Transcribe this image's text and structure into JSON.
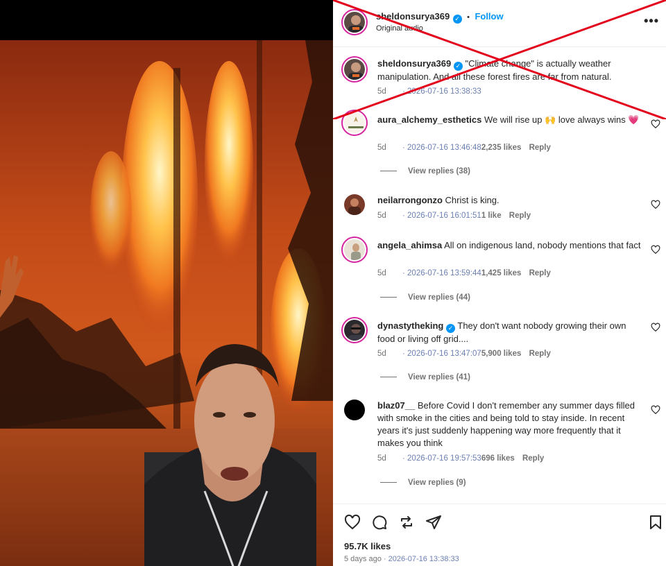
{
  "post": {
    "username": "sheldonsurya369",
    "follow_label": "Follow",
    "audio": "Original audio",
    "more_label": "•••",
    "caption": "\"Climate change\" is actually weather manipulation. And all these forest fires are far from natural.",
    "caption_age": "5d",
    "caption_timestamp": "· 2026-07-16 13:38:33"
  },
  "comments": [
    {
      "username": "aura_alchemy_esthetics",
      "text": "We will rise up 🙌 love always wins 💗",
      "age": "5d",
      "timestamp": "· 2026-07-16 13:46:48",
      "likes": "2,235 likes",
      "reply": "Reply",
      "view_replies": "View replies (38)"
    },
    {
      "username": "neilarrongonzo",
      "text": "Christ is king.",
      "age": "5d",
      "timestamp": "· 2026-07-16 16:01:51",
      "likes": "1 like",
      "reply": "Reply"
    },
    {
      "username": "angela_ahimsa",
      "text": "All on indigenous land, nobody mentions that fact",
      "age": "5d",
      "timestamp": "· 2026-07-16 13:59:44",
      "likes": "1,425 likes",
      "reply": "Reply",
      "view_replies": "View replies (44)"
    },
    {
      "username": "dynastytheking",
      "text": "They don't want nobody growing their own food or living off grid....",
      "age": "5d",
      "timestamp": "· 2026-07-16 13:47:07",
      "likes": "5,900 likes",
      "reply": "Reply",
      "view_replies": "View replies (41)"
    },
    {
      "username": "blaz07__",
      "text": "Before Covid I don't remember any summer days filled with smoke in the cities and being told to stay inside. In recent years it's just suddenly happening way more frequently that it makes you think",
      "age": "5d",
      "timestamp": "· 2026-07-16 19:57:53",
      "likes": "696 likes",
      "reply": "Reply",
      "view_replies": "View replies (9)"
    }
  ],
  "footer": {
    "likes": "95.7K likes",
    "age": "5 days ago",
    "timestamp": "· 2026-07-16 13:38:33"
  },
  "icons": {
    "like": "heart-icon",
    "comment": "comment-icon",
    "share": "repost-icon",
    "send": "send-icon",
    "save": "bookmark-icon"
  },
  "colors": {
    "accent": "#0095f6",
    "overlay_x": "#e3001b",
    "timestamp": "#6b7fb3"
  }
}
